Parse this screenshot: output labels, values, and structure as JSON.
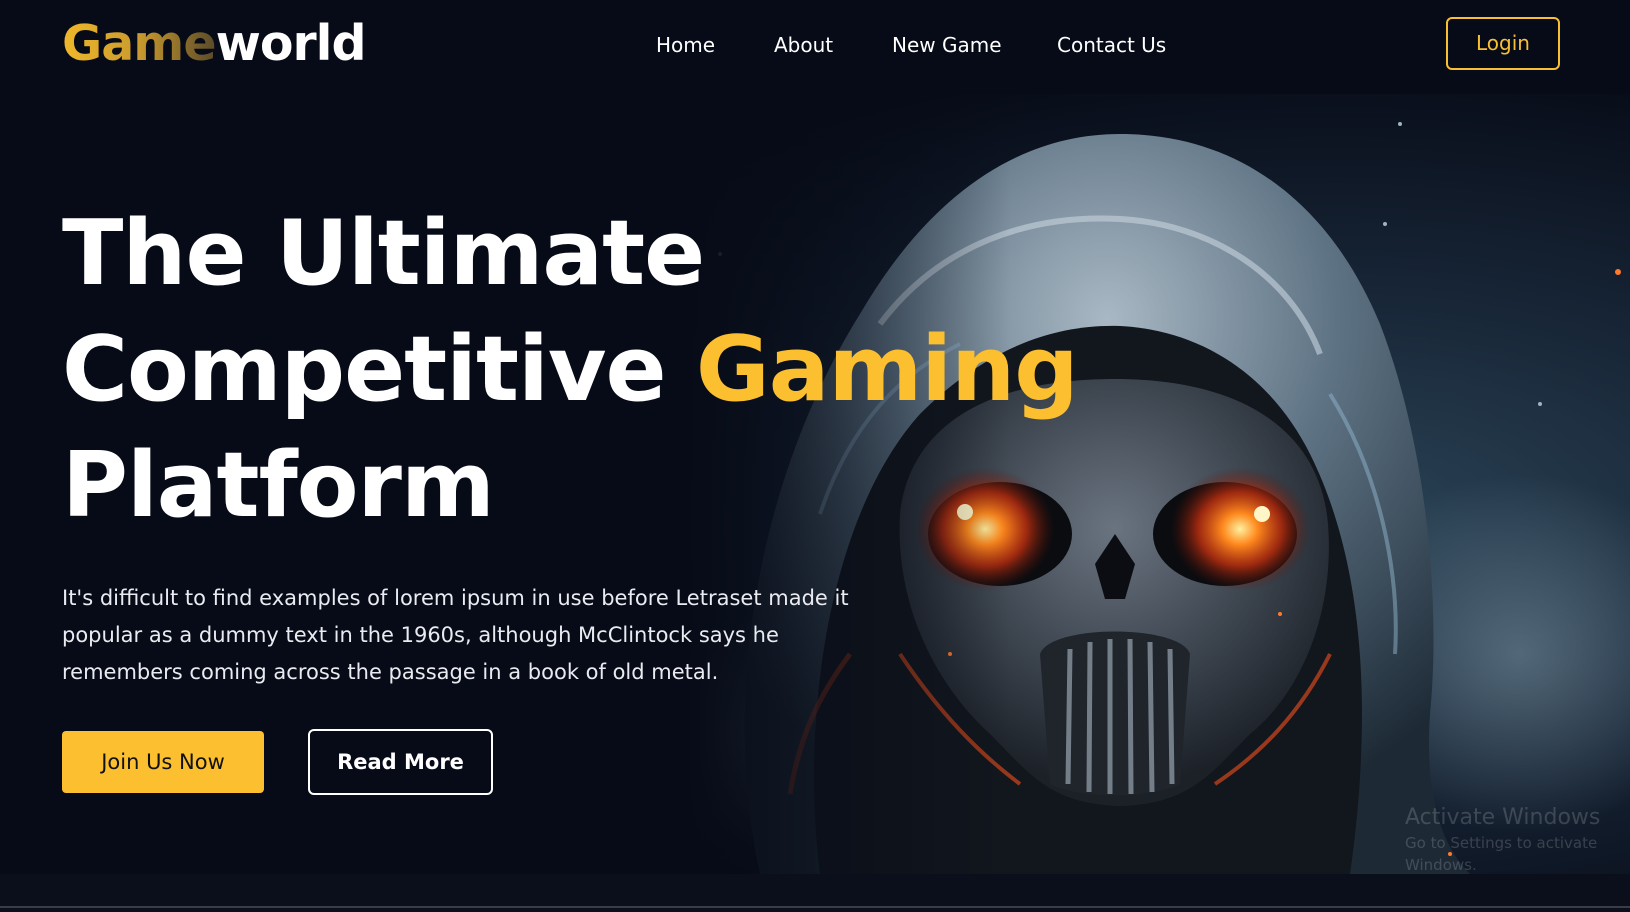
{
  "header": {
    "logo": {
      "part1": "Game",
      "part2": "world"
    },
    "nav": [
      {
        "label": "Home"
      },
      {
        "label": "About"
      },
      {
        "label": "New Game"
      },
      {
        "label": "Contact Us"
      }
    ],
    "login_label": "Login"
  },
  "hero": {
    "title_line1": "The Ultimate",
    "title_line2_a": "Competitive ",
    "title_line2_b": "Gaming",
    "title_line3": "Platform",
    "description": "It's difficult to find examples of lorem ipsum in use before Letraset made it popular as a dummy text in the 1960s, although McClintock says he remembers coming across the passage in a book of old metal.",
    "primary_button": "Join Us Now",
    "secondary_button": "Read More"
  },
  "watermark": {
    "title": "Activate Windows",
    "subtitle": "Go to Settings to activate Windows."
  },
  "colors": {
    "background": "#070b17",
    "accent": "#fbbf2f",
    "text": "#ffffff"
  }
}
